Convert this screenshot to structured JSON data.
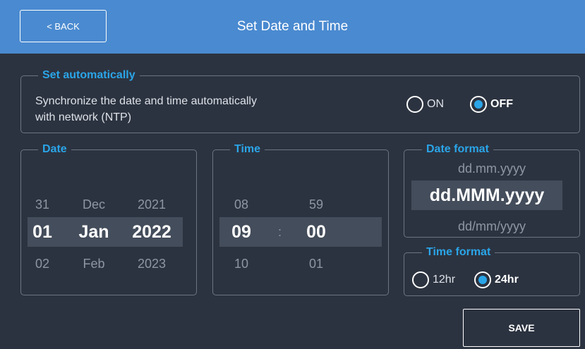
{
  "header": {
    "back_label": "< BACK",
    "title": "Set Date and Time"
  },
  "auto": {
    "legend": "Set automatically",
    "description_line1": "Synchronize the date and time automatically",
    "description_line2": "with network (NTP)",
    "on_label": "ON",
    "off_label": "OFF",
    "selected": "OFF"
  },
  "date": {
    "legend": "Date",
    "day": {
      "prev": "31",
      "current": "01",
      "next": "02"
    },
    "month": {
      "prev": "Dec",
      "current": "Jan",
      "next": "Feb"
    },
    "year": {
      "prev": "2021",
      "current": "2022",
      "next": "2023"
    }
  },
  "time": {
    "legend": "Time",
    "hour": {
      "prev": "08",
      "current": "09",
      "next": "10"
    },
    "minute": {
      "prev": "59",
      "current": "00",
      "next": "01"
    },
    "separator": ":"
  },
  "date_format": {
    "legend": "Date format",
    "prev": "dd.mm.yyyy",
    "current": "dd.MMM.yyyy",
    "next": "dd/mm/yyyy"
  },
  "time_format": {
    "legend": "Time format",
    "option_12": "12hr",
    "option_24": "24hr",
    "selected": "24hr"
  },
  "footer": {
    "save_label": "SAVE"
  },
  "colors": {
    "background": "#2c3340",
    "header": "#4a8ad0",
    "accent": "#2aa5e8",
    "selection": "#444d5b"
  }
}
